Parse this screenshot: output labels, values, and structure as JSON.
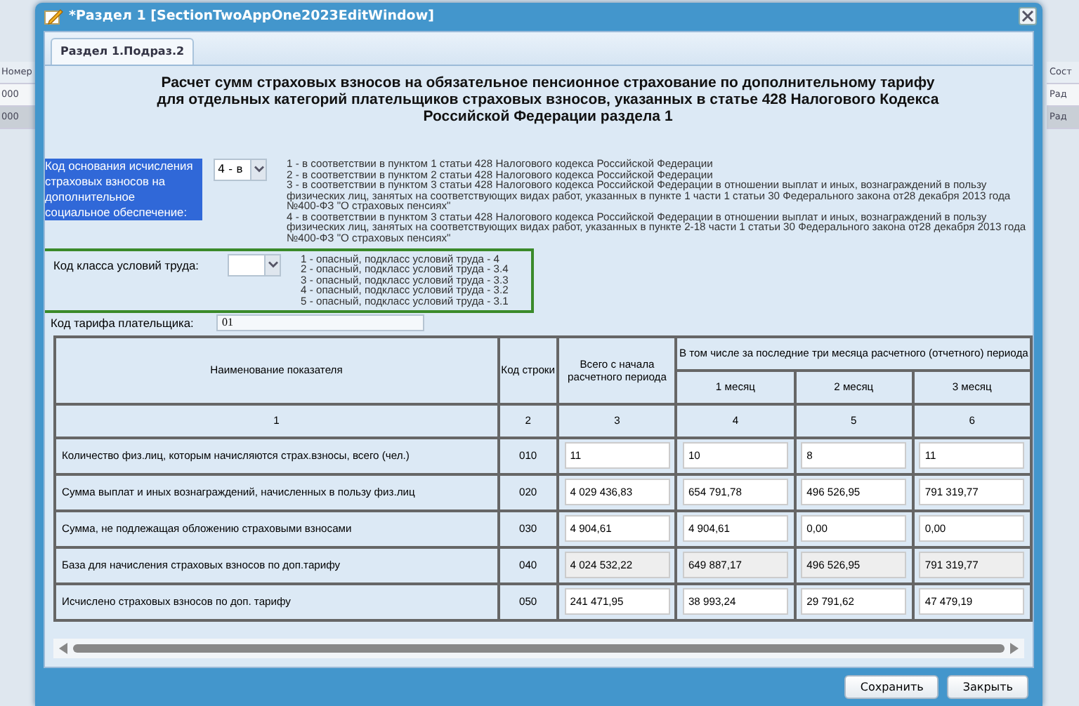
{
  "background_grid": {
    "headers": [
      "Номер",
      "Сост"
    ],
    "rows": [
      {
        "cells": [
          "000",
          "Рад"
        ],
        "selected": false
      },
      {
        "cells": [
          "000",
          "Рад"
        ],
        "selected": true
      }
    ]
  },
  "window": {
    "title": "*Раздел 1 [SectionTwoAppOne2023EditWindow]"
  },
  "tabs": [
    {
      "label": "Раздел 1.Подраз.2",
      "selected": true
    }
  ],
  "form": {
    "title": "Расчет сумм страховых взносов на обязательное пенсионное страхование по дополнительному тарифу для отдельных категорий плательщиков страховых взносов, указанных в статье 428 Налогового Кодекса Российской Федерации раздела 1",
    "basis_field": {
      "label": "Код основания исчисления страховых взносов на дополнительное социальное обеспечение:",
      "value": "4 - в",
      "options": [
        "1 - в соответствии в пунктом 1 статьи 428 Налогового кодекса Российской Федерации",
        "2 - в соответствии в пунктом 2 статьи 428 Налогового кодекса Российской Федерации",
        "3 - в соответствии в пунктом 3 статьи 428 Налогового кодекса Российской Федерации в отношении выплат и иных, вознаграждений в пользу физических лиц, занятых на соответствующих видах работ, указанных в пункте 1 части 1 статьи 30 Федерального закона от28 декабря 2013 года №400-ФЗ \"О страховых пенсиях\"",
        "4 - в соответствии в пунктом 3 статьи 428 Налогового кодекса Российской Федерации в отношении выплат и иных, вознаграждений в пользу физических лиц, занятых на соответствующих видах работ, указанных в пункте 2-18 части 1 статьи 30 Федерального закона от28 декабря 2013 года №400-ФЗ \"О страховых пенсиях\""
      ]
    },
    "labor_class_field": {
      "label": "Код класса условий труда:",
      "options": [
        "1 - опасный, подкласс условий труда - 4",
        "2 - опасный, подкласс условий труда - 3.4",
        "3 - опасный, подкласс условий труда - 3.3",
        "4 - опасный, подкласс условий труда - 3.2",
        "5 - опасный, подкласс условий труда - 3.1"
      ]
    },
    "tariff_field": {
      "label": "Код тарифа плательщика:",
      "value": "01"
    }
  },
  "table": {
    "headers": {
      "name": "Наименование показателя",
      "code": "Код строки",
      "total": "Всего с начала расчетного периода",
      "group": "В том числе за последние три месяца расчетного (отчетного) периода",
      "months": [
        "1 месяц",
        "2 месяц",
        "3 месяц"
      ]
    },
    "column_numbers": [
      "1",
      "2",
      "3",
      "4",
      "5",
      "6"
    ],
    "rows": [
      {
        "name": "Количество физ.лиц, которым начисляются страх.взносы, всего (чел.)",
        "code": "010",
        "values": [
          "11",
          "10",
          "8",
          "11"
        ],
        "readonly": false
      },
      {
        "name": "Сумма выплат и иных вознаграждений, начисленных в пользу физ.лиц",
        "code": "020",
        "values": [
          "4 029 436,83",
          "654 791,78",
          "496 526,95",
          "791 319,77"
        ],
        "readonly": false
      },
      {
        "name": "Сумма, не подлежащая обложению страховыми взносами",
        "code": "030",
        "values": [
          "4 904,61",
          "4 904,61",
          "0,00",
          "0,00"
        ],
        "readonly": false
      },
      {
        "name": "База для начисления страховых взносов по доп.тарифу",
        "code": "040",
        "values": [
          "4 024 532,22",
          "649 887,17",
          "496 526,95",
          "791 319,77"
        ],
        "readonly": true
      },
      {
        "name": "Исчислено страховых взносов по доп. тарифу",
        "code": "050",
        "values": [
          "241 471,95",
          "38 993,24",
          "29 791,62",
          "47 479,19"
        ],
        "readonly": false
      }
    ]
  },
  "buttons": [
    "Сохранить",
    "Закрыть"
  ]
}
